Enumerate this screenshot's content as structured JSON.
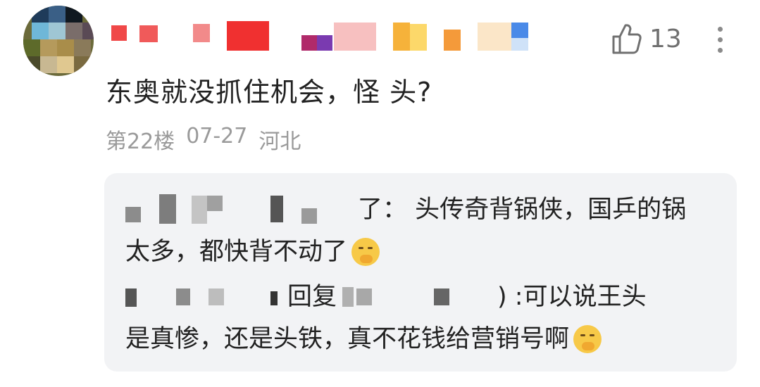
{
  "comment": {
    "author_name": "",
    "text": "东奥就没抓住机会，怪  头?",
    "floor": "第22楼",
    "date": "07-27",
    "location": "河北",
    "like_count": "13",
    "icons": [
      "thumbs-up-icon",
      "more-vertical-icon"
    ]
  },
  "replies": [
    {
      "author": "",
      "text_line1": "了：  头传奇背锅侠，国乒的锅",
      "text_line2": "太多，都快背不动了",
      "emoji": "face-with-hand-over-mouth-emoji"
    },
    {
      "author": "",
      "reply_word": "回复",
      "reply_target": "",
      "text_line1": ")   :可以说王头",
      "text_line2": "是真惨，还是头铁，真不花钱给营销号啊",
      "emoji": "face-with-hand-over-mouth-emoji"
    }
  ],
  "colors": {
    "text": "#222222",
    "meta": "#9a9a9a",
    "reply_bg": "#f2f3f5"
  }
}
